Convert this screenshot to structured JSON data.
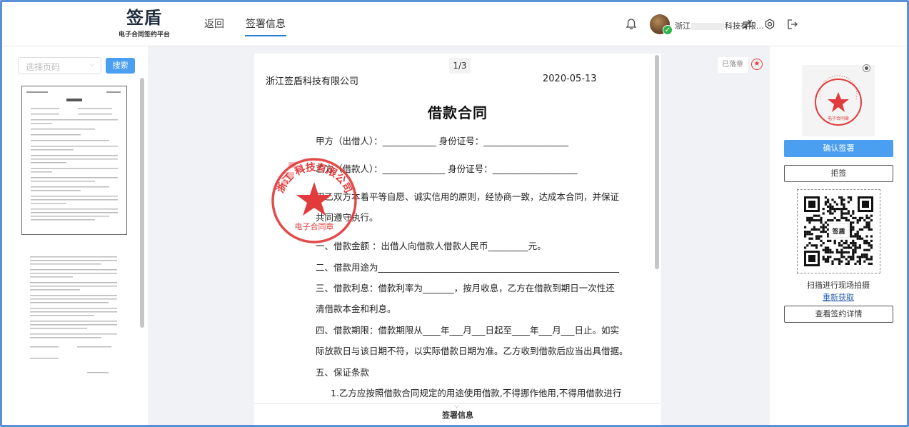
{
  "header": {
    "logo_main": "签盾",
    "logo_sub": "电子合同签约平台",
    "nav_back": "返回",
    "nav_sign_info": "签署信息",
    "company_prefix": "浙江",
    "company_suffix": "科技有限..."
  },
  "left": {
    "page_select_placeholder": "选择页码",
    "search_label": "搜索"
  },
  "doc": {
    "page_indicator": "1/3",
    "company": "浙江签盾科技有限公司",
    "date": "2020-05-13",
    "title": "借款合同",
    "lines": [
      "甲方（出借人）：____________        身份证号：___________________",
      "乙方（借款人）：______________        身份证号：___________________",
      "甲乙双方本着平等自愿、诚实信用的原则，经协商一致，达成本合同，并保证",
      "共同遵守执行。",
      "一、借款金额 ：出借人向借款人借款人民币_________元。",
      "二、借款用途为______________________________________________________",
      "三、借款利息：借款利率为_______，按月收息，乙方在借款到期日一次性还",
      "清借款本金和利息。",
      "四、借款期限：借款期限从____年___月___日起至____年___月___日止。如实",
      "际放款日与该日期不符，以实际借款日期为准。乙方收到借款后应当出具借据。",
      "五、保证条款",
      "1.乙方应按照借款合同规定的用途使用借款,不得挪作他用,不得用借款进行"
    ],
    "seal_top_text": "浙江 科技有限公司",
    "seal_bottom_text": "电子合同章",
    "sign_bar_label": "签署信息"
  },
  "stamped_tag": "已落章",
  "right": {
    "seal_bottom_text": "电子合同章",
    "confirm_label": "确认签署",
    "reject_label": "拒签",
    "qr_center_text": "签盾",
    "qr_label": "扫描进行现场拍摄",
    "qr_refresh": "重新获取",
    "detail_label": "查看签约详情"
  },
  "colors": {
    "accent": "#4a9ff0",
    "seal_red": "#e23b3b",
    "verified_green": "#2fb34a"
  }
}
